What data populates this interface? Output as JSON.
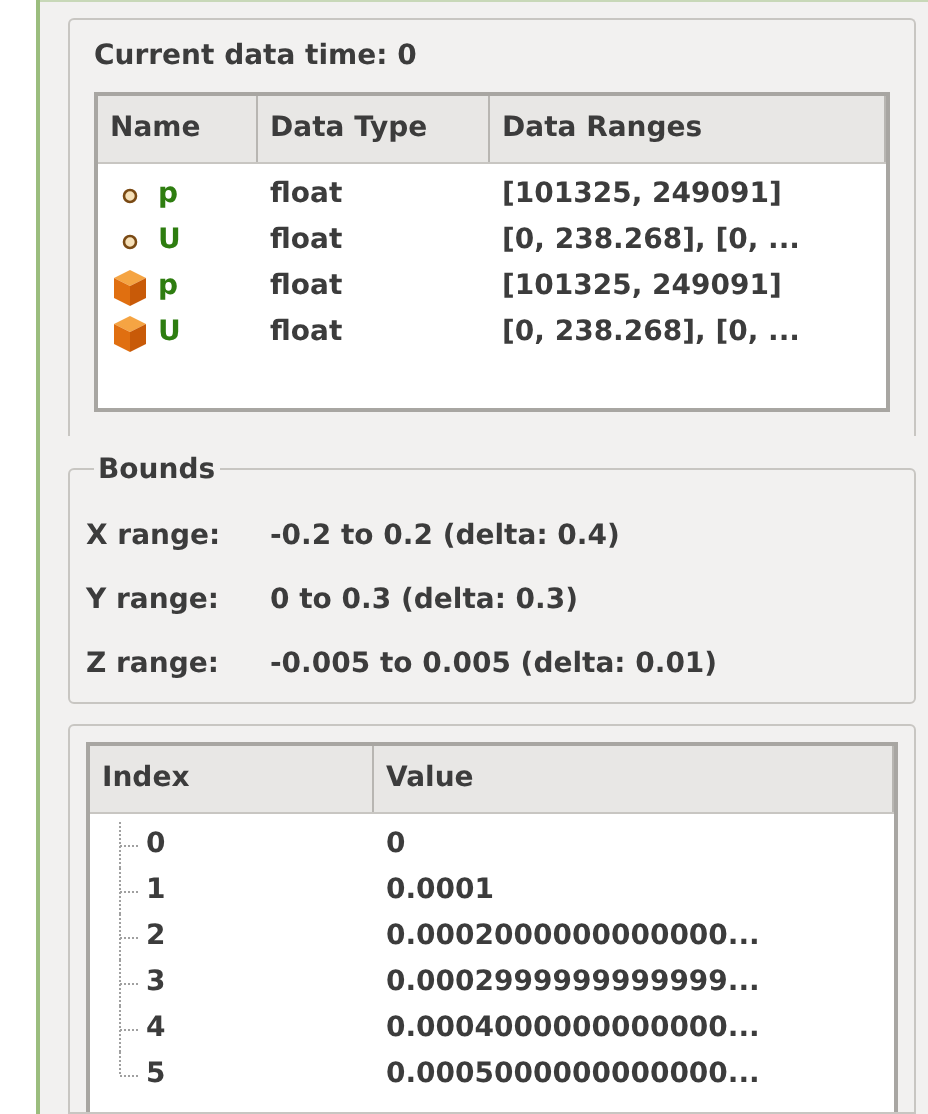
{
  "title": "Current data time: 0",
  "arrays_table": {
    "columns": [
      "Name",
      "Data Type",
      "Data Ranges"
    ],
    "rows": [
      {
        "kind": "point",
        "name": "p",
        "type": "float",
        "ranges": "[101325, 249091]"
      },
      {
        "kind": "point",
        "name": "U",
        "type": "float",
        "ranges": "[0, 238.268], [0, ..."
      },
      {
        "kind": "cell",
        "name": "p",
        "type": "float",
        "ranges": "[101325, 249091]"
      },
      {
        "kind": "cell",
        "name": "U",
        "type": "float",
        "ranges": "[0, 238.268], [0, ..."
      }
    ]
  },
  "bounds": {
    "title": "Bounds",
    "rows": [
      {
        "label": "X range:",
        "value": "-0.2 to 0.2 (delta: 0.4)"
      },
      {
        "label": "Y range:",
        "value": "0 to 0.3 (delta: 0.3)"
      },
      {
        "label": "Z range:",
        "value": "-0.005 to 0.005 (delta: 0.01)"
      }
    ]
  },
  "values_table": {
    "columns": [
      "Index",
      "Value"
    ],
    "rows": [
      {
        "index": "0",
        "value": "0"
      },
      {
        "index": "1",
        "value": "0.0001"
      },
      {
        "index": "2",
        "value": "0.0002000000000000..."
      },
      {
        "index": "3",
        "value": "0.0002999999999999..."
      },
      {
        "index": "4",
        "value": "0.0004000000000000..."
      },
      {
        "index": "5",
        "value": "0.0005000000000000..."
      }
    ]
  }
}
